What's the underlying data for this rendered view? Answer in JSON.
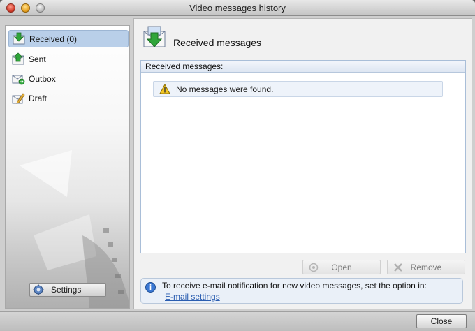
{
  "window": {
    "title": "Video messages history"
  },
  "sidebar": {
    "items": [
      {
        "label": "Received (0)",
        "icon": "inbox-download-icon",
        "selected": true
      },
      {
        "label": "Sent",
        "icon": "sent-upload-icon",
        "selected": false
      },
      {
        "label": "Outbox",
        "icon": "outbox-icon",
        "selected": false
      },
      {
        "label": "Draft",
        "icon": "draft-pencil-icon",
        "selected": false
      }
    ],
    "settings_label": "Settings"
  },
  "main": {
    "title": "Received messages",
    "list_header": "Received messages:",
    "empty_notice": "No messages were found.",
    "actions": {
      "open_label": "Open",
      "remove_label": "Remove"
    },
    "info": {
      "text": "To receive e-mail notification for new video messages, set the option in:",
      "link": "E-mail settings"
    }
  },
  "footer": {
    "close_label": "Close"
  },
  "colors": {
    "selection": "#b9cfe9",
    "link": "#2a5db0",
    "accent_green": "#2fa53a"
  }
}
